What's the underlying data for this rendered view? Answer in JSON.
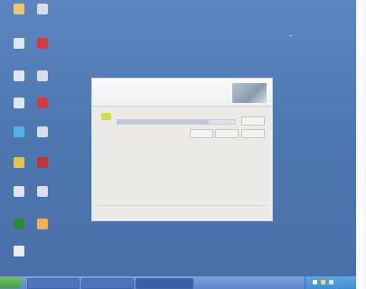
{
  "desktop_icons": [
    {
      "id": "icon-1",
      "name": "desktop-icon-1",
      "caption": "",
      "color": "#e9c86e"
    },
    {
      "id": "icon-2",
      "name": "desktop-icon-2",
      "caption": "",
      "color": "#d9dee6"
    },
    {
      "id": "icon-3",
      "name": "desktop-icon-3",
      "caption": "",
      "color": "#dfe6f5"
    },
    {
      "id": "icon-4",
      "name": "desktop-icon-4",
      "caption": "",
      "color": "#d53b3b"
    },
    {
      "id": "icon-5",
      "name": "desktop-icon-5",
      "caption": "",
      "color": "#dfe6f5"
    },
    {
      "id": "icon-6",
      "name": "desktop-icon-6",
      "caption": "",
      "color": "#d9dee6"
    },
    {
      "id": "icon-7",
      "name": "desktop-icon-7",
      "caption": "",
      "color": "#dfe6f5"
    },
    {
      "id": "icon-8",
      "name": "desktop-icon-8",
      "caption": "",
      "color": "#d53b3b"
    },
    {
      "id": "icon-9",
      "name": "desktop-icon-9",
      "caption": "",
      "color": "#4fb1e4"
    },
    {
      "id": "icon-10",
      "name": "desktop-icon-10",
      "caption": "",
      "color": "#d9dee6"
    },
    {
      "id": "icon-11",
      "name": "desktop-icon-11",
      "caption": "",
      "color": "#e2c64b"
    },
    {
      "id": "icon-12",
      "name": "desktop-icon-12",
      "caption": "",
      "color": "#c1333a"
    },
    {
      "id": "icon-13",
      "name": "desktop-icon-13",
      "caption": "",
      "color": "#dfe6f5"
    },
    {
      "id": "icon-14",
      "name": "desktop-icon-14",
      "caption": "",
      "color": "#d9dee6"
    },
    {
      "id": "icon-15",
      "name": "desktop-icon-15",
      "caption": "",
      "color": "#2b8a39"
    },
    {
      "id": "icon-16",
      "name": "desktop-icon-16",
      "caption": "",
      "color": "#f0b24a"
    },
    {
      "id": "icon-17",
      "name": "desktop-icon-17",
      "caption": "",
      "color": "#e8edf6"
    }
  ],
  "dialog": {
    "title": "",
    "subtitle": "",
    "status_text": "",
    "progress": 0.78,
    "side_button": "",
    "buttons": [
      "",
      "",
      ""
    ]
  },
  "taskbar": {
    "buttons": [
      "",
      "",
      ""
    ],
    "clock": ""
  }
}
